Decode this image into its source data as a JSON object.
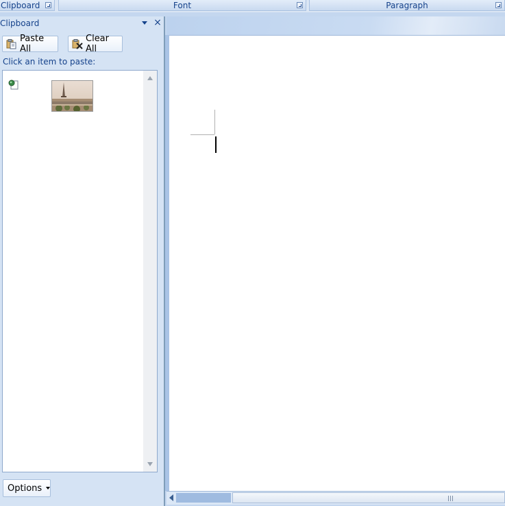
{
  "ribbon": {
    "groups": [
      {
        "label": "Clipboard"
      },
      {
        "label": "Font"
      },
      {
        "label": "Paragraph"
      }
    ]
  },
  "pane": {
    "title": "Clipboard",
    "paste_all": "Paste All",
    "clear_all": "Clear All",
    "hint": "Click an item to paste:",
    "options": "Options",
    "items": [
      {
        "type": "image",
        "thumbnail": "eiffel-tower-photo"
      }
    ]
  },
  "icons": {
    "pane_close": "×"
  },
  "colors": {
    "accent_text": "#15428b",
    "pane_bg": "#d5e3f4",
    "ribbon_border": "#a9c1e1"
  }
}
